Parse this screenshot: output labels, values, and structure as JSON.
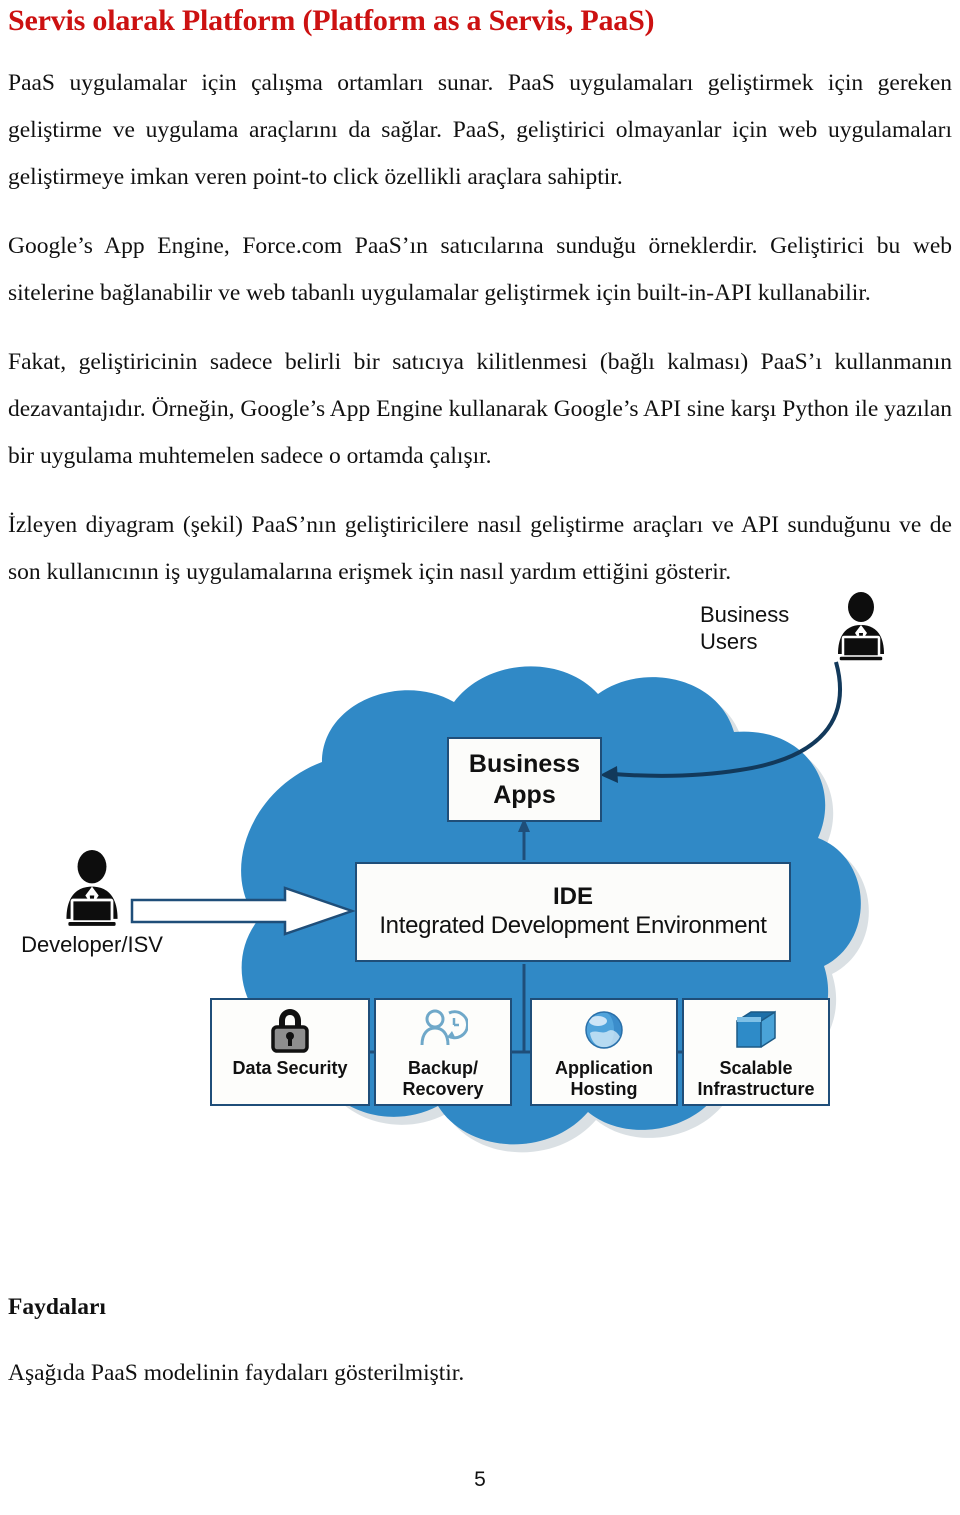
{
  "document": {
    "title": "Servis olarak Platform (Platform as a Servis, PaaS)",
    "title_color": "#CC1111",
    "page_number": "5",
    "paragraphs": [
      "PaaS uygulamalar için çalışma ortamları sunar. PaaS uygulamaları geliştirmek için gereken geliştirme ve uygulama araçlarını da sağlar.  PaaS, geliştirici olmayanlar için web uygulamaları geliştirmeye imkan veren point-to click özellikli araçlara sahiptir.",
      "Google’s App Engine, Force.com PaaS’ın satıcılarına sunduğu örneklerdir. Geliştirici bu web sitelerine bağlanabilir ve web tabanlı uygulamalar geliştirmek için built-in-API kullanabilir.",
      "Fakat, geliştiricinin sadece belirli bir satıcıya kilitlenmesi (bağlı kalması) PaaS’ı kullanmanın dezavantajıdır. Örneğin, Google’s App Engine kullanarak Google’s API sine karşı Python ile yazılan bir uygulama muhtemelen sadece o ortamda çalışır.",
      "İzleyen diyagram (şekil) PaaS’nın geliştiricilere nasıl geliştirme araçları ve API sunduğunu ve de son kullanıcının iş uygulamalarına erişmek için nasıl yardım ettiğini gösterir."
    ],
    "section_heading": "Faydaları",
    "closing_text": "Aşağıda PaaS modelinin faydaları gösterilmiştir."
  },
  "diagram": {
    "cloud_color": "#3089C6",
    "cloud_shadow_color": "#B9C4CC",
    "box_border_color": "#1F4E79",
    "box_fill_color": "#FCFCFA",
    "actors": [
      {
        "id": "business-users",
        "label": "Business\nUsers",
        "icon": "person-at-laptop-icon"
      },
      {
        "id": "developer-isv",
        "label": "Developer/ISV",
        "icon": "person-at-laptop-icon"
      }
    ],
    "nodes": [
      {
        "id": "business-apps",
        "label": "Business\nApps"
      },
      {
        "id": "ide",
        "abbr": "IDE",
        "full": "Integrated Development Environment"
      }
    ],
    "services": [
      {
        "id": "data-security",
        "label": "Data Security",
        "icon": "padlock-icon"
      },
      {
        "id": "backup-recovery",
        "label": "Backup/\nRecovery",
        "icon": "person-clock-icon"
      },
      {
        "id": "application-hosting",
        "label": "Application\nHosting",
        "icon": "globe-icon"
      },
      {
        "id": "scalable-infrastructure",
        "label": "Scalable\nInfrastructure",
        "icon": "box-cube-icon"
      }
    ],
    "connections": [
      {
        "from": "business-users",
        "to": "business-apps",
        "style": "curved-arrow"
      },
      {
        "from": "ide",
        "to": "business-apps",
        "style": "straight-arrow-up"
      },
      {
        "from": "developer-isv",
        "to": "ide",
        "style": "block-arrow-right"
      },
      {
        "from": "ide",
        "to": "services",
        "style": "tree-connector"
      }
    ]
  }
}
